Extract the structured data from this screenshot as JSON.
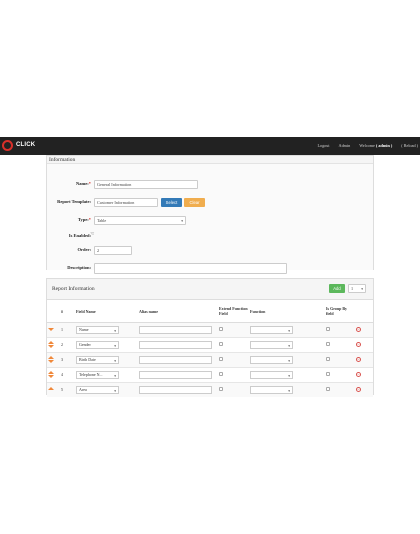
{
  "navbar": {
    "logo_text": "CLICK",
    "logout": "Logout",
    "admin": "Admin",
    "welcome": "Welcome",
    "welcome_user": "( admin )",
    "reload": "( Reload )"
  },
  "info_panel": {
    "title": "Information",
    "name_label": "Name:",
    "name_value": "General Information",
    "template_label": "Report Template:",
    "template_value": "Customer Information",
    "select_button": "Select",
    "clear_button": "Clear",
    "type_label": "Type:",
    "type_value": "Table",
    "enabled_label": "Is Enabled:",
    "order_label": "Order:",
    "order_value": "2",
    "description_label": "Description:",
    "description_value": ""
  },
  "report_panel": {
    "title": "Report Information",
    "add_button": "Add",
    "page_select": "1",
    "columns": [
      "#",
      "Field Name",
      "Alias name",
      "Extend Function Field",
      "Function",
      "Is Group By field"
    ],
    "rows": [
      {
        "num": "1",
        "field": "Name",
        "alias": ""
      },
      {
        "num": "2",
        "field": "Gender",
        "alias": ""
      },
      {
        "num": "3",
        "field": "Birth Date",
        "alias": ""
      },
      {
        "num": "4",
        "field": "Telephone N...",
        "alias": ""
      },
      {
        "num": "5",
        "field": "Area",
        "alias": ""
      }
    ]
  }
}
